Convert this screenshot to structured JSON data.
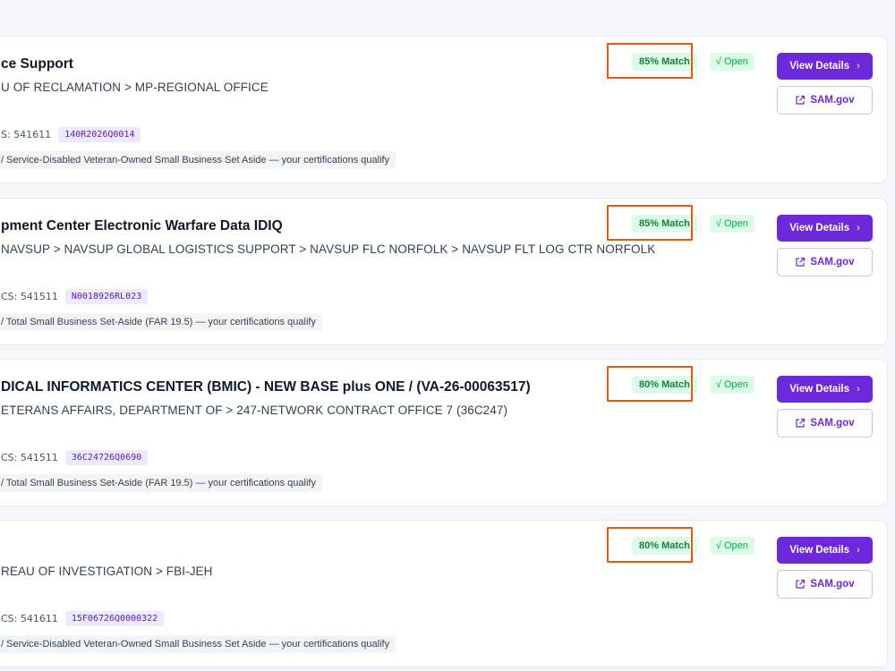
{
  "ui": {
    "view_details_label": "View Details",
    "view_details_chevron": "›",
    "sam_label": "SAM.gov",
    "accent_color": "#6d28d9",
    "match_bg_color": "#dcfce7",
    "highlight_color": "#ea580c"
  },
  "opportunities": [
    {
      "title": "ce Support",
      "agency": "U OF RECLAMATION > MP-REGIONAL OFFICE",
      "naics": "S: 541611",
      "solicitation": "140R2026Q0014",
      "certification": "/ Service-Disabled Veteran-Owned Small Business Set Aside — your certifications qualify",
      "match": "85% Match",
      "status": "√ Open"
    },
    {
      "title": "pment Center Electronic Warfare Data IDIQ",
      "agency": " NAVSUP > NAVSUP GLOBAL LOGISTICS SUPPORT > NAVSUP FLC NORFOLK > NAVSUP FLT LOG CTR NORFOLK",
      "naics": "CS: 541511",
      "solicitation": "N0018926RL023",
      "certification": "/ Total Small Business Set-Aside (FAR 19.5) — your certifications qualify",
      "match": "85% Match",
      "status": "√ Open"
    },
    {
      "title": "DICAL INFORMATICS CENTER (BMIC) - NEW BASE plus ONE / (VA-26-00063517)",
      "agency": "ETERANS AFFAIRS, DEPARTMENT OF > 247-NETWORK CONTRACT OFFICE 7 (36C247)",
      "naics": "CS: 541511",
      "solicitation": "36C24726Q0690",
      "certification": "/ Total Small Business Set-Aside (FAR 19.5) — your certifications qualify",
      "match": "80% Match",
      "status": "√ Open"
    },
    {
      "title": "",
      "agency": "REAU OF INVESTIGATION > FBI-JEH",
      "naics": "CS: 541611",
      "solicitation": "15F06726Q0000322",
      "certification": "/ Service-Disabled Veteran-Owned Small Business Set Aside — your certifications qualify",
      "match": "80% Match",
      "status": "√ Open"
    }
  ]
}
